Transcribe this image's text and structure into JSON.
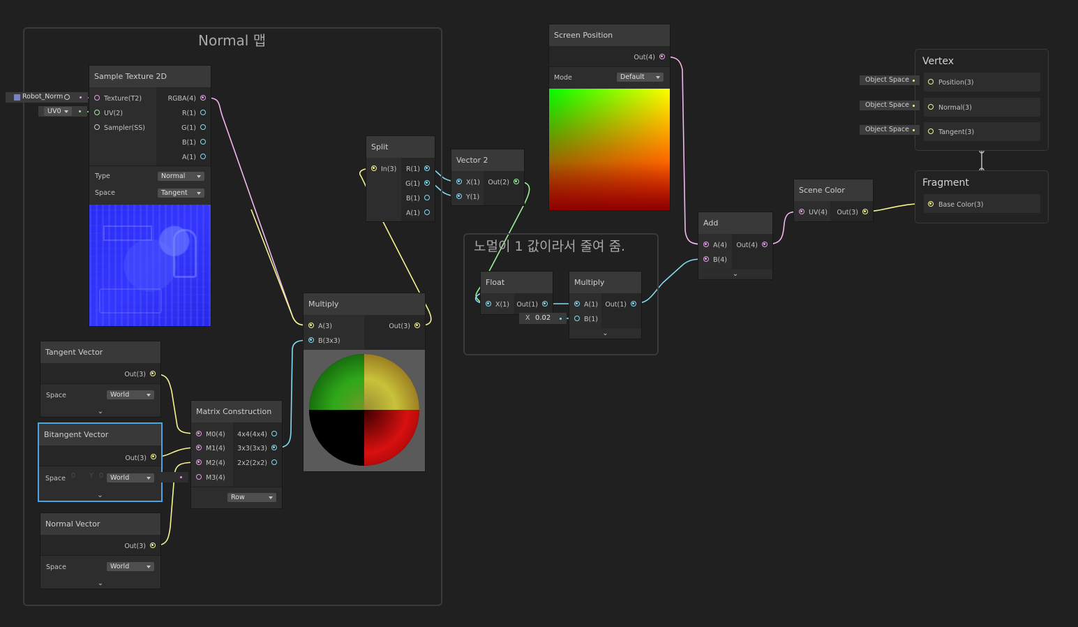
{
  "graph": {
    "group_normal": {
      "title": "Normal 맵"
    },
    "group_note": {
      "title": "노멀이 1 값이라서 줄여 줌."
    },
    "sample_texture": {
      "title": "Sample Texture 2D",
      "inputs": [
        "Texture(T2)",
        "UV(2)",
        "Sampler(SS)"
      ],
      "outputs": [
        "RGBA(4)",
        "R(1)",
        "G(1)",
        "B(1)",
        "A(1)"
      ],
      "type_label": "Type",
      "type_value": "Normal",
      "space_label": "Space",
      "space_value": "Tangent",
      "texture_field": "Robot_Norm",
      "uv_field": "UV0"
    },
    "tangent_vector": {
      "title": "Tangent Vector",
      "out": "Out(3)",
      "space_label": "Space",
      "space_value": "World"
    },
    "bitangent_vector": {
      "title": "Bitangent Vector",
      "out": "Out(3)",
      "space_label": "Space",
      "space_value": "World",
      "ghost_x": "0",
      "ghost_y": "Y",
      "ghost_y_val": "0"
    },
    "normal_vector": {
      "title": "Normal Vector",
      "out": "Out(3)",
      "space_label": "Space",
      "space_value": "World"
    },
    "matrix_construction": {
      "title": "Matrix Construction",
      "inputs": [
        "M0(4)",
        "M1(4)",
        "M2(4)",
        "M3(4)"
      ],
      "outputs": [
        "4x4(4x4)",
        "3x3(3x3)",
        "2x2(2x2)"
      ],
      "mode_value": "Row"
    },
    "multiply_main": {
      "title": "Multiply",
      "inputs": [
        "A(3)",
        "B(3x3)"
      ],
      "out": "Out(3)"
    },
    "split": {
      "title": "Split",
      "input": "In(3)",
      "outputs": [
        "R(1)",
        "G(1)",
        "B(1)",
        "A(1)"
      ]
    },
    "vector2": {
      "title": "Vector 2",
      "inputs": [
        "X(1)",
        "Y(1)"
      ],
      "out": "Out(2)"
    },
    "screen_position": {
      "title": "Screen Position",
      "out": "Out(4)",
      "mode_label": "Mode",
      "mode_value": "Default"
    },
    "float_node": {
      "title": "Float",
      "input": "X(1)",
      "out": "Out(1)",
      "field_label": "X",
      "field_value": "0.02"
    },
    "multiply_small": {
      "title": "Multiply",
      "inputs": [
        "A(1)",
        "B(1)"
      ],
      "out": "Out(1)"
    },
    "add": {
      "title": "Add",
      "inputs": [
        "A(4)",
        "B(4)"
      ],
      "out": "Out(4)"
    },
    "scene_color": {
      "title": "Scene Color",
      "input": "UV(4)",
      "out": "Out(3)"
    },
    "vertex": {
      "title": "Vertex",
      "slots": [
        "Position(3)",
        "Normal(3)",
        "Tangent(3)"
      ],
      "pills": [
        "Object Space",
        "Object Space",
        "Object Space"
      ]
    },
    "fragment": {
      "title": "Fragment",
      "slots": [
        "Base Color(3)"
      ]
    }
  },
  "colors": {
    "background": "#202020",
    "header": "#393939",
    "port_vector4": "#e39ee4",
    "port_vector3": "#f4f490",
    "port_vector2": "#9ff09d",
    "port_vector1": "#84dbf1",
    "matrix": "#84dbf1",
    "selection": "#4aa6e0"
  },
  "icons": [
    "chevron-down-icon",
    "target-icon",
    "texture-swatch-icon"
  ]
}
